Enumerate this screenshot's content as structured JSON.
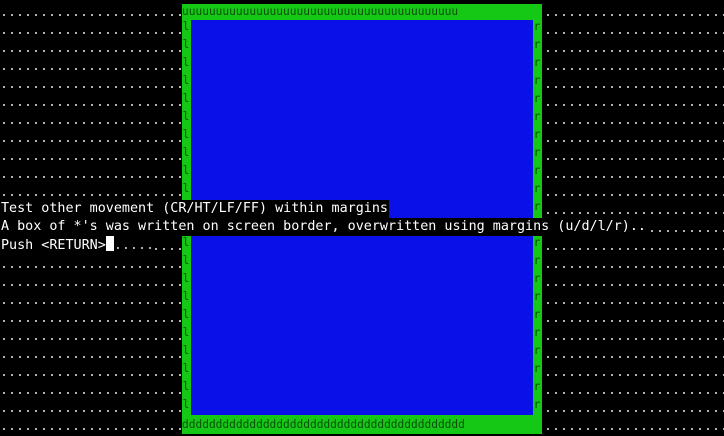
{
  "terminal": {
    "margin_box": {
      "top_edge": "uuuuuuuuuuuuuuuuuuuuuuuuuuuuuuuuuuuuuuuuu",
      "bottom_edge": "dddddddddddddddddddddddddddddddddddddddddd",
      "left_char": "l",
      "right_char": "r",
      "border_color": "#16c816",
      "fill_color": "#0a10e8"
    },
    "lines": [
      "Test other movement (CR/HT/LF/FF) within margins",
      "A box of *'s was written on screen border, overwritten using margins (u/d/l/r)..",
      "Push <RETURN>"
    ],
    "trailing_dots": "....."
  }
}
